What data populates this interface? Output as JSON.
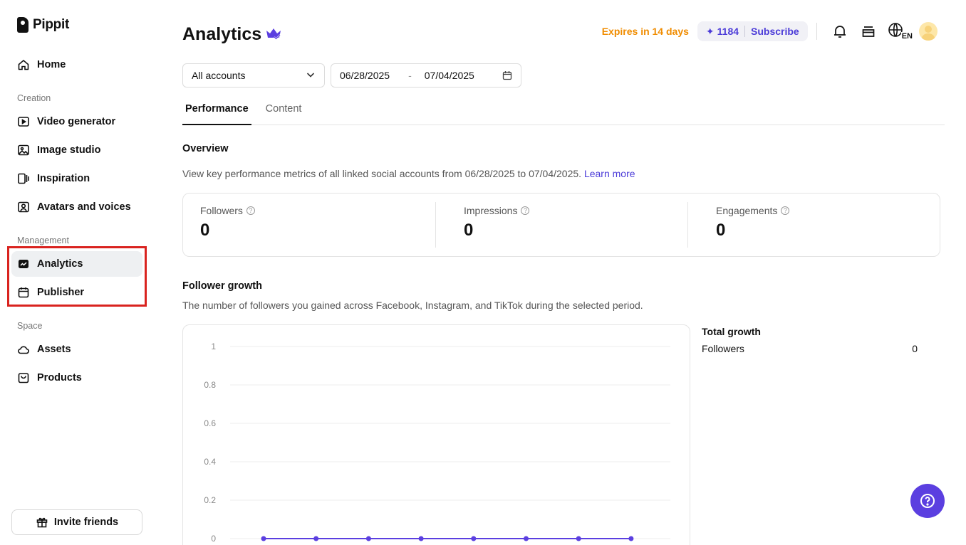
{
  "app": {
    "name": "Pippit"
  },
  "sidebar": {
    "home": "Home",
    "sections": {
      "creation": "Creation",
      "management": "Management",
      "space": "Space"
    },
    "creation_items": [
      "Video generator",
      "Image studio",
      "Inspiration",
      "Avatars and voices"
    ],
    "management_items": [
      "Analytics",
      "Publisher"
    ],
    "space_items": [
      "Assets",
      "Products"
    ],
    "invite": "Invite friends"
  },
  "header": {
    "title": "Analytics",
    "expires": "Expires in 14 days",
    "credits": "1184",
    "subscribe": "Subscribe",
    "language": "EN"
  },
  "filters": {
    "account": "All accounts",
    "date_from": "06/28/2025",
    "date_to": "07/04/2025",
    "date_sep": "-"
  },
  "tabs": [
    "Performance",
    "Content"
  ],
  "overview": {
    "title": "Overview",
    "description": "View key performance metrics of all linked social accounts from 06/28/2025 to 07/04/2025.",
    "learn_more": "Learn more",
    "metrics": [
      {
        "label": "Followers",
        "value": "0"
      },
      {
        "label": "Impressions",
        "value": "0"
      },
      {
        "label": "Engagements",
        "value": "0"
      }
    ]
  },
  "follower_growth": {
    "title": "Follower growth",
    "description": "The number of followers you gained across Facebook, Instagram, and TikTok during the selected period.",
    "total_title": "Total growth",
    "total_label": "Followers",
    "total_value": "0"
  },
  "chart_data": {
    "type": "line",
    "y_ticks": [
      "1",
      "0.8",
      "0.6",
      "0.4",
      "0.2",
      "0"
    ],
    "ylim": [
      0,
      1
    ],
    "series": [
      {
        "values": [
          0,
          0,
          0,
          0,
          0,
          0,
          0,
          0
        ]
      }
    ],
    "color": "#5b3fe0",
    "grid": true
  },
  "colors": {
    "accent": "#4b3bd8",
    "warning": "#f08c00",
    "highlight": "#d9231f",
    "help": "#5b3fe0"
  }
}
